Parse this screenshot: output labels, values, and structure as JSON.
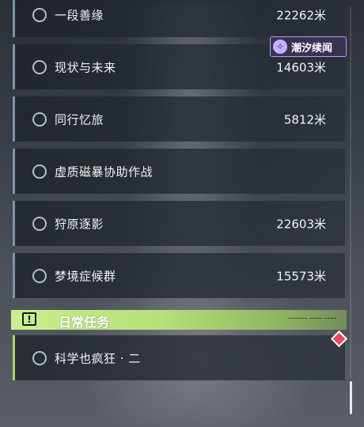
{
  "quests": [
    {
      "name": "一段善缘",
      "distance": "22262米"
    },
    {
      "name": "现状与未来",
      "distance": "14603米"
    },
    {
      "name": "同行忆旅",
      "distance": "5812米"
    },
    {
      "name": "虚质磁暴协助作战",
      "distance": ""
    },
    {
      "name": "狩原逐影",
      "distance": "22603米"
    },
    {
      "name": "梦境症候群",
      "distance": "15573米"
    }
  ],
  "daily": {
    "header": "日常任务",
    "badge": "!",
    "header_decoration": "━━━━━━ ━━━━ ━━━━",
    "quests": [
      {
        "name": "科学也疯狂 · 二"
      }
    ]
  },
  "tag": {
    "label": "潮汐续闻",
    "icon": "tide-swirl-icon"
  },
  "colors": {
    "accent_blue": "#7d96a8",
    "daily_green": "#b6e07a",
    "tag_purple": "#b59cff",
    "marker_red": "#e8495a"
  }
}
